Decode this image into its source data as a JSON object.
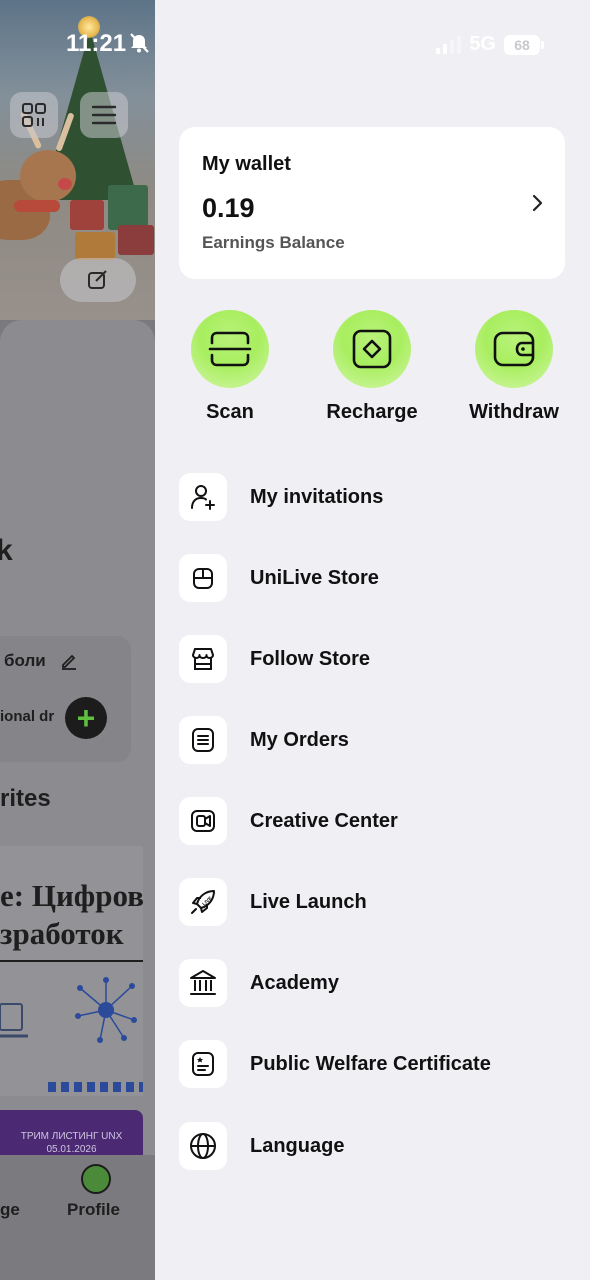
{
  "status_bar": {
    "time": "11:21",
    "network": "5G",
    "battery": "68"
  },
  "background": {
    "edit_text": "боли",
    "add_text": "ional dr",
    "favorites_text": "rites",
    "article_line1": "е: Цифров",
    "article_line2": "зработок",
    "banner_line1": "ТРИМ ЛИСТИНГ UNX",
    "banner_line2": "05.01.2026",
    "nav_left": "ge",
    "nav_profile": "Profile",
    "big_letter": "k"
  },
  "wallet": {
    "title": "My wallet",
    "amount": "0.19",
    "label": "Earnings Balance"
  },
  "actions": [
    {
      "label": "Scan",
      "icon": "scan-icon"
    },
    {
      "label": "Recharge",
      "icon": "recharge-icon"
    },
    {
      "label": "Withdraw",
      "icon": "wallet-icon"
    }
  ],
  "menu": [
    {
      "label": "My invitations",
      "icon": "add-user-icon"
    },
    {
      "label": "UniLive Store",
      "icon": "store-bag-icon"
    },
    {
      "label": "Follow Store",
      "icon": "storefront-icon"
    },
    {
      "label": "My Orders",
      "icon": "orders-list-icon"
    },
    {
      "label": "Creative Center",
      "icon": "video-camera-icon"
    },
    {
      "label": "Live Launch",
      "icon": "rocket-icon"
    },
    {
      "label": "Academy",
      "icon": "academy-building-icon"
    },
    {
      "label": "Public Welfare Certificate",
      "icon": "certificate-icon"
    },
    {
      "label": "Language",
      "icon": "globe-icon"
    }
  ]
}
